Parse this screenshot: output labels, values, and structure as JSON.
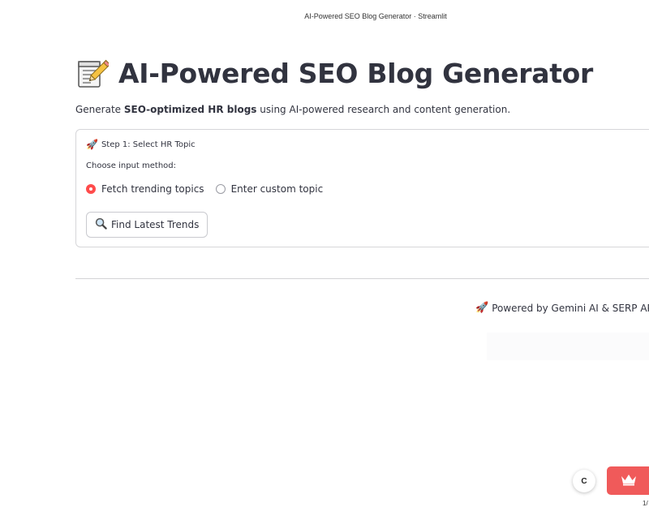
{
  "browser": {
    "tab_title": "AI-Powered SEO Blog Generator · Streamlit"
  },
  "header": {
    "title_icon": "memo-icon",
    "title": "AI-Powered SEO Blog Generator"
  },
  "intro": {
    "prefix": "Generate ",
    "bold": "SEO-optimized HR blogs",
    "suffix": " using AI-powered research and content generation."
  },
  "step1": {
    "icon": "rocket-icon",
    "label": "Step 1: Select HR Topic",
    "method_label": "Choose input method:",
    "options": [
      {
        "label": "Fetch trending topics",
        "selected": true
      },
      {
        "label": "Enter custom topic",
        "selected": false
      }
    ],
    "button_icon": "magnifier-icon",
    "button_label": "Find Latest Trends"
  },
  "footer": {
    "icon": "rocket-icon",
    "credit": "Powered by Gemini AI & SERP API",
    "extra": "⊞ ⊕"
  },
  "widgets": {
    "c_button_label": "C",
    "crown_icon": "crown-icon",
    "page_indicator": "1/"
  },
  "colors": {
    "accent": "#ff4b4b",
    "crown_bg": "#f05a5a",
    "text": "#31333f",
    "border": "#d6d6d9"
  }
}
